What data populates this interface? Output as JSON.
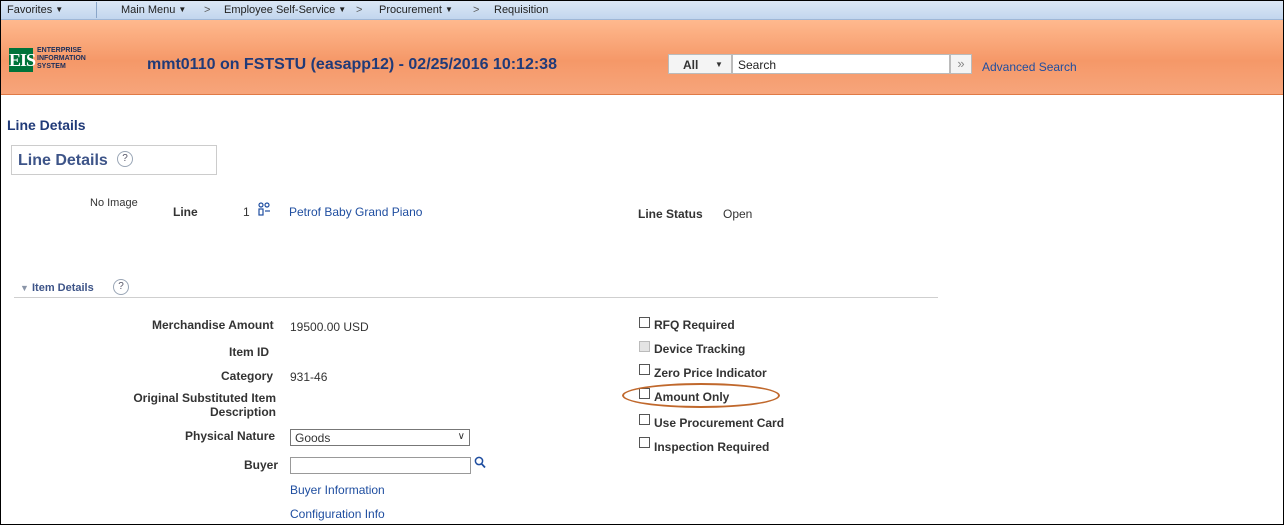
{
  "nav": {
    "favorites": "Favorites",
    "main_menu": "Main Menu",
    "employee_self_service": "Employee Self-Service",
    "procurement": "Procurement",
    "requisition": "Requisition"
  },
  "header": {
    "logo_text": "EIS",
    "logo_line1": "ENTERPRISE",
    "logo_line2": "INFORMATION",
    "logo_line3": "SYSTEM",
    "title": "mmt0110 on FSTSTU (easapp12) - 02/25/2016 10:12:38",
    "search_scope": "All",
    "search_placeholder": "Search",
    "advanced_search": "Advanced Search"
  },
  "page": {
    "title": "Line Details",
    "section_title": "Line Details",
    "help_glyph": "?",
    "no_image": "No Image",
    "line_label": "Line",
    "line_number": "1",
    "line_description": "Petrof Baby Grand Piano",
    "line_status_label": "Line Status",
    "line_status_value": "Open"
  },
  "item_details": {
    "header": "Item Details",
    "merch_amount_label": "Merchandise Amount",
    "merch_amount_value": "19500.00 USD",
    "item_id_label": "Item ID",
    "category_label": "Category",
    "category_value": "931-46",
    "orig_sub_label_1": "Original Substituted Item",
    "orig_sub_label_2": "Description",
    "physical_nature_label": "Physical Nature",
    "physical_nature_value": "Goods",
    "buyer_label": "Buyer",
    "buyer_info_link": "Buyer Information",
    "config_info_link": "Configuration Info",
    "checkboxes": [
      {
        "label": "RFQ Required",
        "checked": false,
        "disabled": false
      },
      {
        "label": "Device Tracking",
        "checked": false,
        "disabled": true
      },
      {
        "label": "Zero Price Indicator",
        "checked": false,
        "disabled": false
      },
      {
        "label": "Amount Only",
        "checked": false,
        "disabled": false
      },
      {
        "label": "Use Procurement Card",
        "checked": false,
        "disabled": false
      },
      {
        "label": "Inspection Required",
        "checked": false,
        "disabled": false
      }
    ]
  },
  "colors": {
    "header_orange": "#f59868",
    "nav_blue": "#c2d6ee",
    "link_blue": "#1f4ea0",
    "highlight_ellipse": "#c0682c"
  }
}
